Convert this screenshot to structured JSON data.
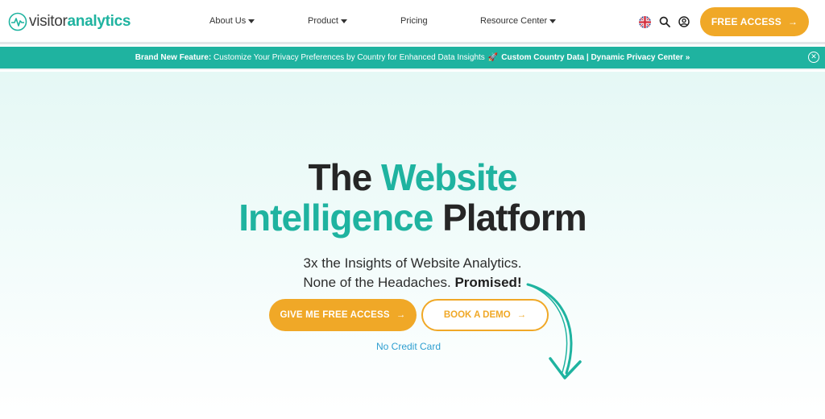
{
  "brand": {
    "logo_part1": "visitor",
    "logo_part2": "analytics",
    "logo_icon": "pulse-circle-icon",
    "color_primary": "#1fb3a0",
    "color_accent": "#f0a827"
  },
  "nav": {
    "about": "About Us",
    "product": "Product",
    "pricing": "Pricing",
    "resource": "Resource Center",
    "language_icon": "uk-flag-icon",
    "search_icon": "search-icon",
    "account_icon": "user-icon",
    "cta_label": "FREE ACCESS",
    "cta_arrow": "→"
  },
  "announcement": {
    "lead": "Brand New Feature:",
    "text": "Customize Your Privacy Preferences by Country for Enhanced Data Insights",
    "emoji": "🚀",
    "link1": "Custom Country Data",
    "separator": "|",
    "link2": "Dynamic Privacy Center »",
    "close": "✕"
  },
  "hero": {
    "headline_part1": "The ",
    "headline_part2": "Website",
    "headline_part3": "Intelligence",
    "headline_part4": " Platform",
    "sub_line1": "3x the Insights of Website Analytics.",
    "sub_line2": "None of the Headaches. ",
    "sub_line2_bold": "Promised!",
    "primary_cta": "GIVE ME FREE ACCESS",
    "secondary_cta": "BOOK A DEMO",
    "arrow": "→",
    "note": "No Credit Card"
  }
}
